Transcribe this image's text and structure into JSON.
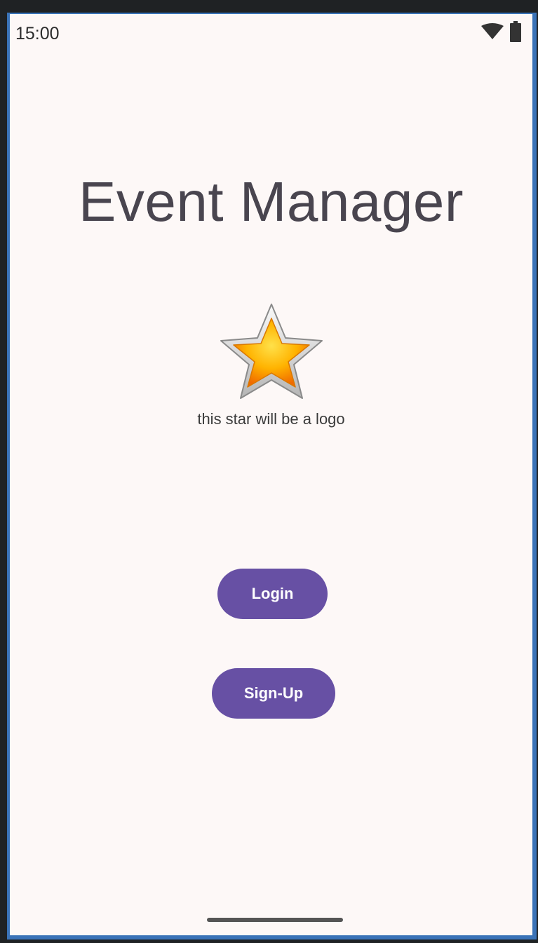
{
  "status_bar": {
    "time": "15:00",
    "icons": [
      "wifi-icon",
      "battery-icon"
    ]
  },
  "app": {
    "title": "Event Manager",
    "logo_caption": "this star will be a logo",
    "logo_icon": "star-icon"
  },
  "buttons": {
    "login_label": "Login",
    "signup_label": "Sign-Up"
  },
  "colors": {
    "accent": "#6750a4",
    "background": "#fdf8f7",
    "title_text": "#49454f"
  }
}
